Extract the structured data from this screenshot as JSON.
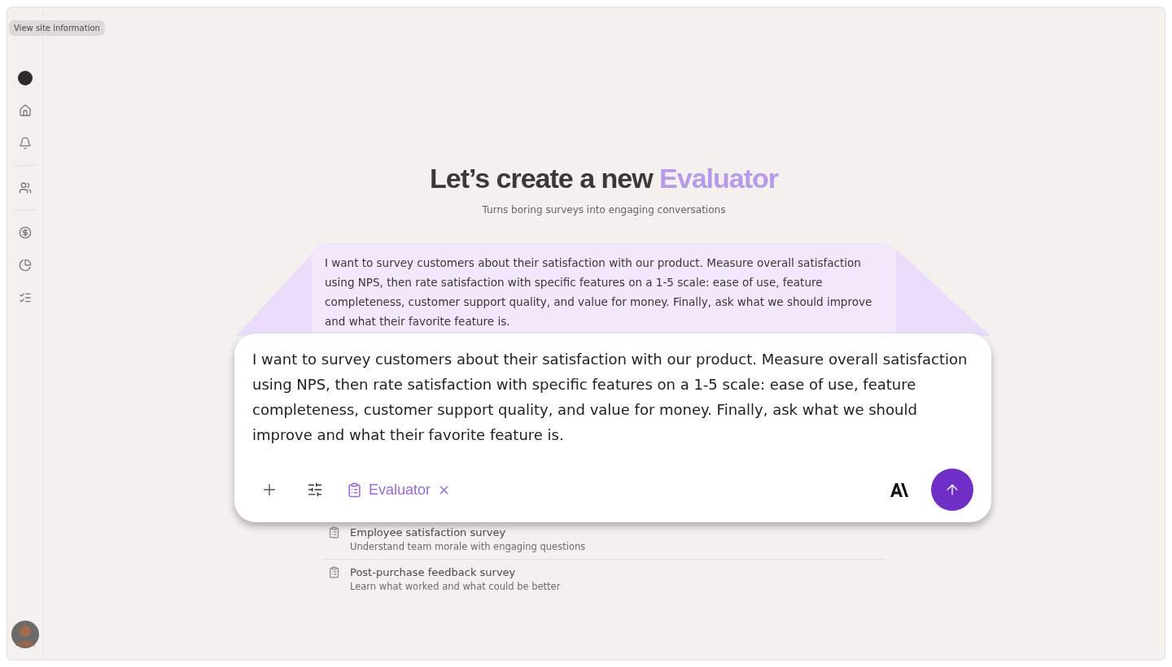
{
  "tooltip": {
    "text": "View site information"
  },
  "sidebar": {
    "items": [
      {
        "kind": "logo",
        "selected": true
      },
      {
        "kind": "home",
        "selected": false
      },
      {
        "kind": "bell",
        "selected": false
      },
      {
        "kind": "users",
        "selected": false
      },
      {
        "kind": "dollar",
        "selected": false
      },
      {
        "kind": "chart",
        "selected": false
      },
      {
        "kind": "list",
        "selected": false
      }
    ]
  },
  "heading": {
    "text": "Let’s create a new",
    "highlight": "Evaluator"
  },
  "subtitle": "Turns boring surveys into engaging conversations",
  "background_prompt": "I want to survey customers about their satisfaction with our product. Measure overall satisfaction using NPS, then rate satisfaction with specific features on a 1-5 scale: ease of use, feature completeness, customer support quality, and value for money. Finally, ask what we should improve and what their favorite feature is.",
  "suggestions": [
    {
      "title": "Employee satisfaction survey",
      "description": "Understand team morale with engaging questions"
    },
    {
      "title": "Post-purchase feedback survey",
      "description": "Learn what worked and what could be better"
    }
  ],
  "composer": {
    "value": "I want to survey customers about their satisfaction with our product. Measure overall satisfaction using NPS, then rate satisfaction with specific features on a 1-5 scale: ease of use, feature completeness, customer support quality, and value for money. Finally, ask what we should improve and what their favorite feature is.",
    "chip": {
      "label": "Evaluator"
    }
  }
}
